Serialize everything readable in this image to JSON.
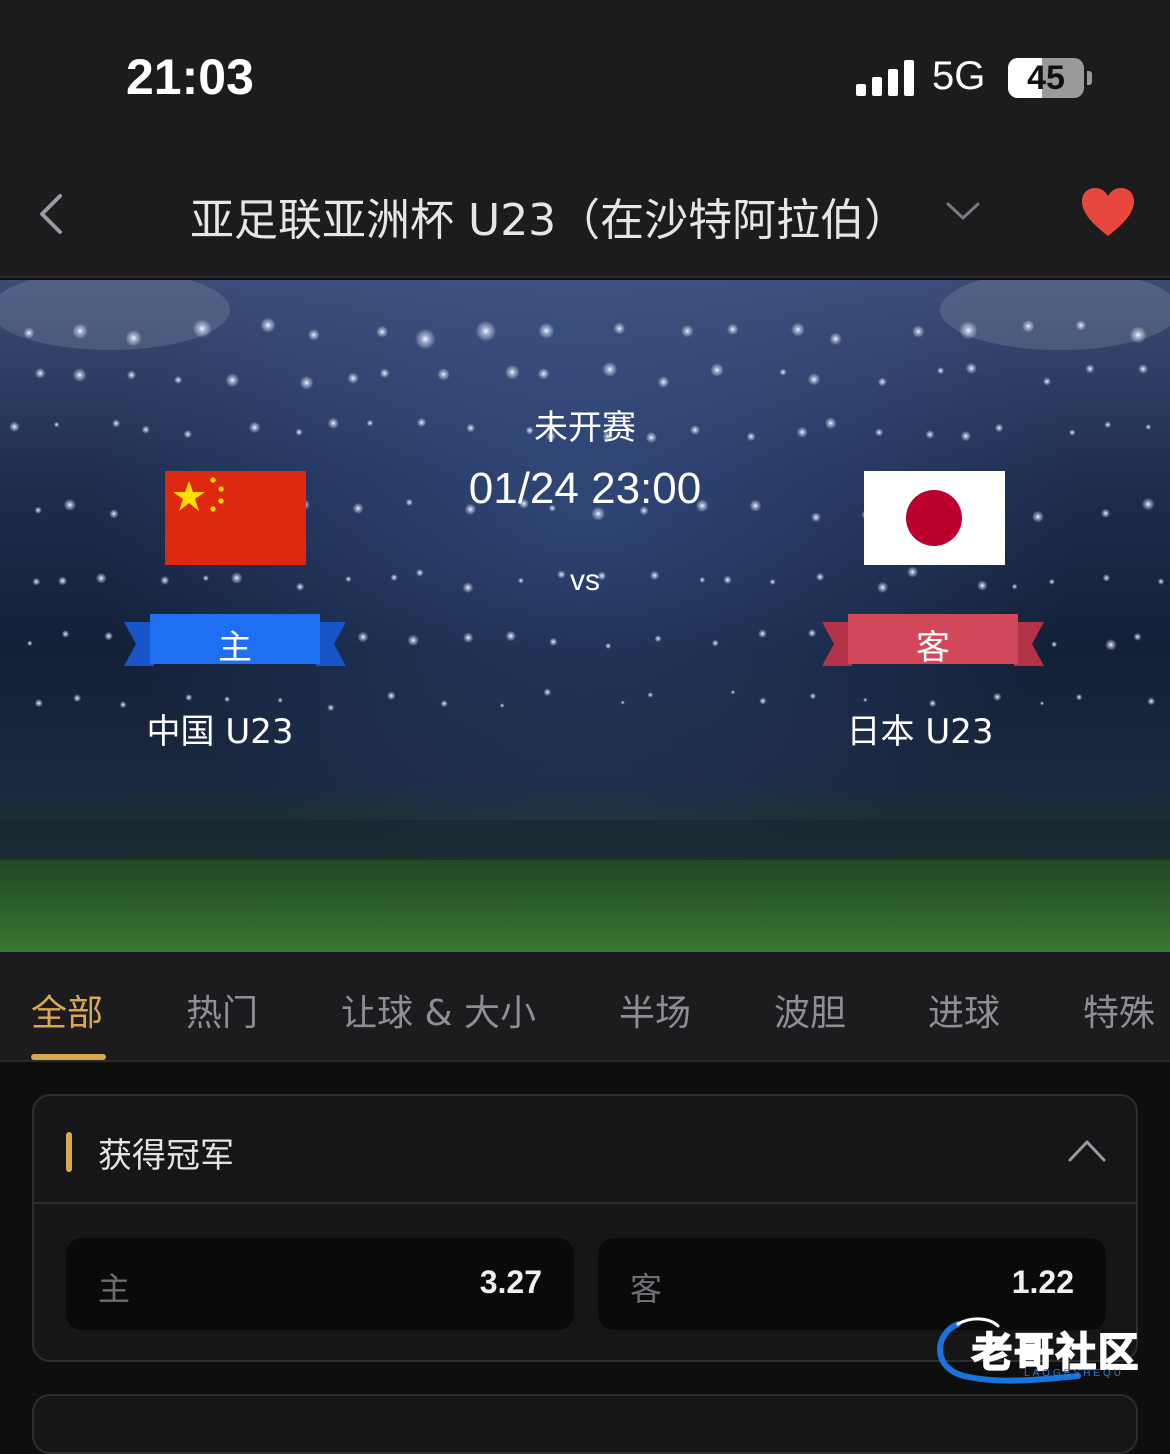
{
  "status_bar": {
    "time": "21:03",
    "network": "5G",
    "battery": "45",
    "battery_level": 0.45
  },
  "nav": {
    "title": "亚足联亚洲杯 U23（在沙特阿拉伯）",
    "favorite_color": "#e8473d"
  },
  "match": {
    "status": "未开赛",
    "datetime": "01/24 23:00",
    "vs": "vs",
    "home": {
      "badge": "主",
      "name": "中国 U23",
      "badge_color": "#1f6ff2"
    },
    "away": {
      "badge": "客",
      "name": "日本 U23",
      "badge_color": "#d2485a"
    }
  },
  "tabs": [
    {
      "label": "全部",
      "active": true
    },
    {
      "label": "热门",
      "active": false
    },
    {
      "label": "让球 & 大小",
      "active": false
    },
    {
      "label": "半场",
      "active": false
    },
    {
      "label": "波胆",
      "active": false
    },
    {
      "label": "进球",
      "active": false
    },
    {
      "label": "特殊",
      "active": false
    }
  ],
  "market": {
    "title": "获得冠军",
    "odds": [
      {
        "label": "主",
        "value": "3.27"
      },
      {
        "label": "客",
        "value": "1.22"
      }
    ]
  },
  "watermark": {
    "text": "老哥社区",
    "sub": "LAOGESHEQU"
  },
  "accent_color": "#d8a94e"
}
